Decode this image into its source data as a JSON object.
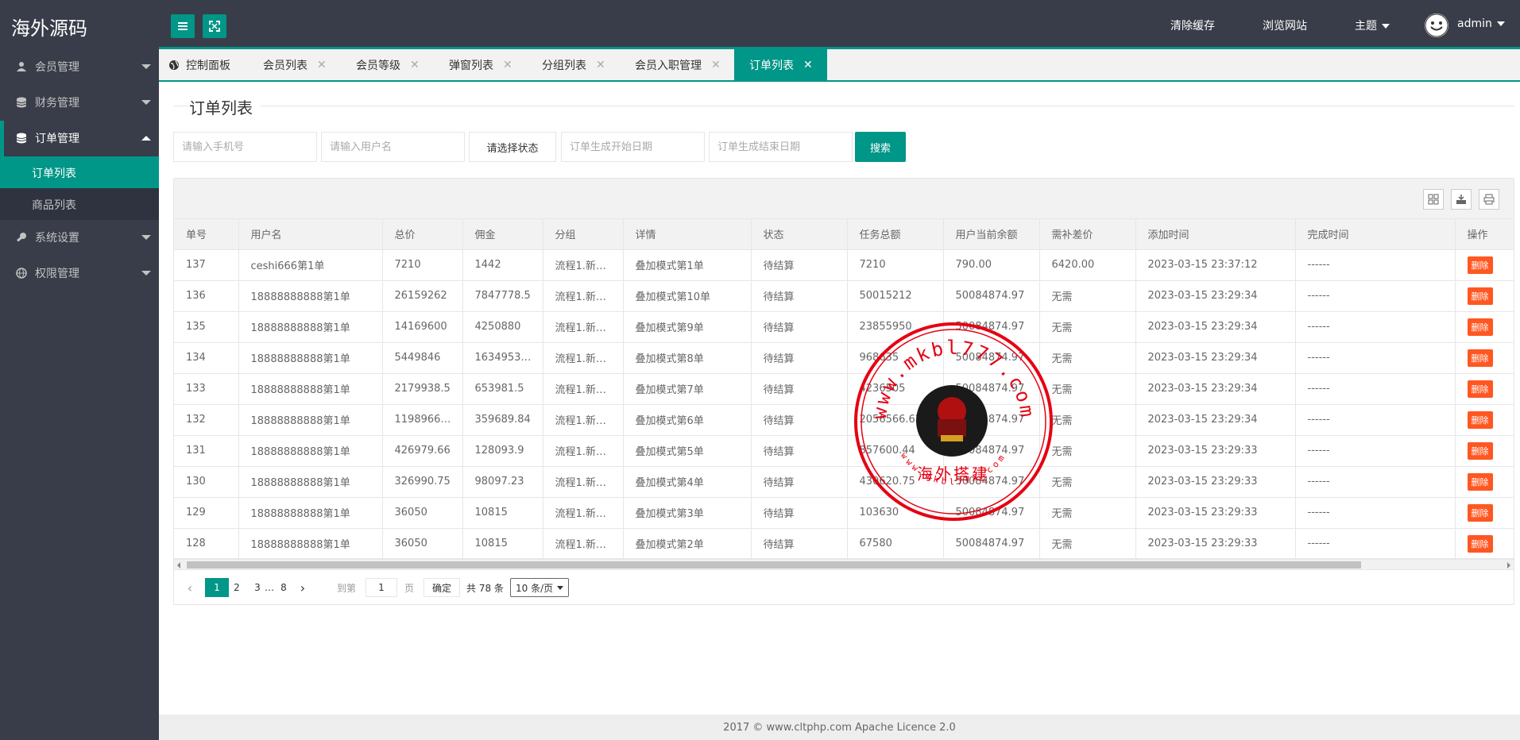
{
  "header": {
    "logo": "海外源码",
    "clear_cache": "清除缓存",
    "browse_site": "浏览网站",
    "theme": "主题",
    "user": "admin"
  },
  "sidebar": {
    "menus": [
      {
        "label": "会员管理",
        "icon": "user-icon"
      },
      {
        "label": "财务管理",
        "icon": "database-icon"
      },
      {
        "label": "订单管理",
        "icon": "database-icon"
      },
      {
        "label": "系统设置",
        "icon": "wrench-icon"
      },
      {
        "label": "权限管理",
        "icon": "globe-icon"
      }
    ],
    "sub_items": [
      "订单列表",
      "商品列表"
    ]
  },
  "tabs": [
    "控制面板",
    "会员列表",
    "会员等级",
    "弹窗列表",
    "分组列表",
    "会员入职管理",
    "订单列表"
  ],
  "page_title": "订单列表",
  "filters": {
    "phone_placeholder": "请输入手机号",
    "username_placeholder": "请输入用户名",
    "status_select": "请选择状态",
    "start_placeholder": "订单生成开始日期",
    "end_placeholder": "订单生成结束日期",
    "search": "搜索"
  },
  "table": {
    "headers": [
      "单号",
      "用户名",
      "总价",
      "佣金",
      "分组",
      "详情",
      "状态",
      "任务总额",
      "用户当前余额",
      "需补差价",
      "添加时间",
      "完成时间",
      "操作"
    ],
    "rows": [
      [
        "137",
        "ceshi666第1单",
        "7210",
        "1442",
        "流程1.新…",
        "叠加模式第1单",
        "待结算",
        "7210",
        "790.00",
        "6420.00",
        "2023-03-15 23:37:12",
        "------",
        "删除"
      ],
      [
        "136",
        "18888888888第1单",
        "26159262",
        "7847778.5",
        "流程1.新…",
        "叠加模式第10单",
        "待结算",
        "50015212",
        "50084874.97",
        "无需",
        "2023-03-15 23:29:34",
        "------",
        "删除"
      ],
      [
        "135",
        "18888888888第1单",
        "14169600",
        "4250880",
        "流程1.新…",
        "叠加模式第9单",
        "待结算",
        "23855950",
        "50084874.97",
        "无需",
        "2023-03-15 23:29:34",
        "------",
        "删除"
      ],
      [
        "134",
        "18888888888第1单",
        "5449846",
        "1634953…",
        "流程1.新…",
        "叠加模式第8单",
        "待结算",
        "968635",
        "50084874.97",
        "无需",
        "2023-03-15 23:29:34",
        "------",
        "删除"
      ],
      [
        "133",
        "18888888888第1单",
        "2179938.5",
        "653981.5",
        "流程1.新…",
        "叠加模式第7单",
        "待结算",
        "4236505",
        "50084874.97",
        "无需",
        "2023-03-15 23:29:34",
        "------",
        "删除"
      ],
      [
        "132",
        "18888888888第1单",
        "1198966…",
        "359689.84",
        "流程1.新…",
        "叠加模式第6单",
        "待结算",
        "2056566.62",
        "50084874.97",
        "无需",
        "2023-03-15 23:29:34",
        "------",
        "删除"
      ],
      [
        "131",
        "18888888888第1单",
        "426979.66",
        "128093.9",
        "流程1.新…",
        "叠加模式第5单",
        "待结算",
        "857600.44",
        "50084874.97",
        "无需",
        "2023-03-15 23:29:33",
        "------",
        "删除"
      ],
      [
        "130",
        "18888888888第1单",
        "326990.75",
        "98097.23",
        "流程1.新…",
        "叠加模式第4单",
        "待结算",
        "430620.75",
        "50084874.97",
        "无需",
        "2023-03-15 23:29:33",
        "------",
        "删除"
      ],
      [
        "129",
        "18888888888第1单",
        "36050",
        "10815",
        "流程1.新…",
        "叠加模式第3单",
        "待结算",
        "103630",
        "50084874.97",
        "无需",
        "2023-03-15 23:29:33",
        "------",
        "删除"
      ],
      [
        "128",
        "18888888888第1单",
        "36050",
        "10815",
        "流程1.新…",
        "叠加模式第2单",
        "待结算",
        "67580",
        "50084874.97",
        "无需",
        "2023-03-15 23:29:33",
        "------",
        "删除"
      ]
    ]
  },
  "pager": {
    "pages": [
      "1",
      "2",
      "3",
      "…",
      "8"
    ],
    "goto_label": "到第",
    "goto_value": "1",
    "page_unit": "页",
    "confirm": "确定",
    "total": "共 78 条",
    "page_size": "10 条/页"
  },
  "footer": "2017 ©  www.cltphp.com  Apache Licence 2.0",
  "stamp": {
    "top_text": "www.mkbl777.com",
    "center_text": "海外搭建",
    "bottom_text": "www.mkbl777.com",
    "color": "#e60012"
  },
  "colors": {
    "accent": "#009688",
    "danger": "#ff5722",
    "sidebar": "#393d49"
  }
}
